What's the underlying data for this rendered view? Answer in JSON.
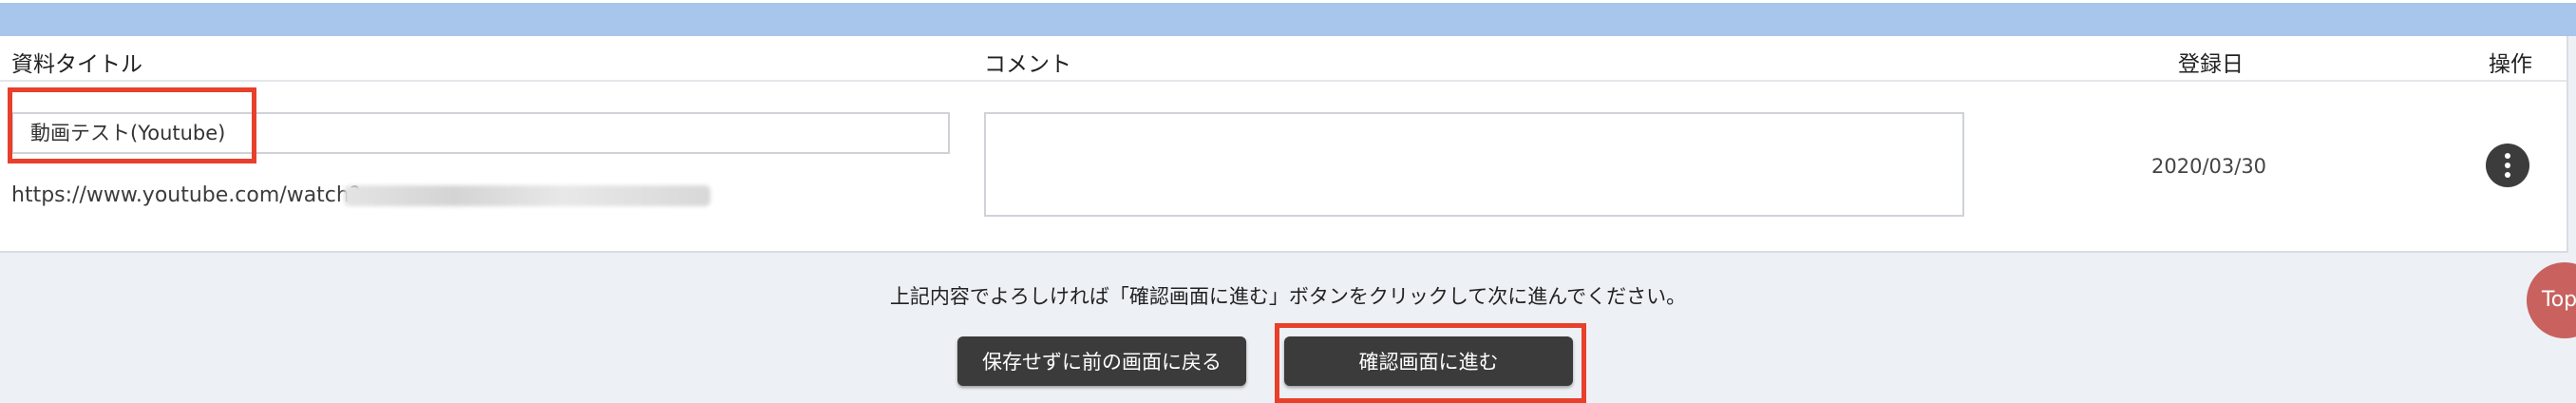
{
  "table": {
    "headers": {
      "title": "資料タイトル",
      "comment": "コメント",
      "registered_date": "登録日",
      "operations": "操作"
    },
    "row": {
      "title_value": "動画テスト(Youtube)",
      "url_visible": "https://www.youtube.com/watch?",
      "comment_value": "",
      "registered_date": "2020/03/30",
      "menu_icon": "more-vertical-icon"
    }
  },
  "footer": {
    "instruction": "上記内容でよろしければ「確認画面に進む」ボタンをクリックして次に進んでください。",
    "back_button": "保存せずに前の画面に戻る",
    "next_button": "確認画面に進む",
    "scroll_top": "Top"
  },
  "colors": {
    "header_band": "#a8c6ec",
    "button_bg": "#3b3b3b",
    "highlight": "#e8402b",
    "top_button": "#c9615f"
  }
}
